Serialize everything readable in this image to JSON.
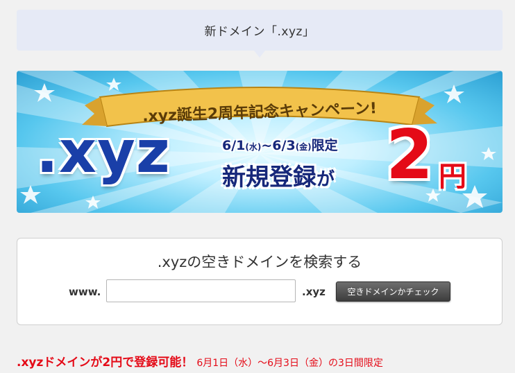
{
  "header": {
    "title": "新ドメイン「.xyz」"
  },
  "banner": {
    "ribbon": ".xyz誕生2周年記念キャンペーン!",
    "logo": ".xyz",
    "date_start": "6/1",
    "day_start": "(水)",
    "tilde": "~",
    "date_end": "6/3",
    "day_end": "(金)",
    "limited": "限定",
    "new_reg": "新規登録",
    "ga": "が",
    "price": "2",
    "yen": "円"
  },
  "search": {
    "title": ".xyzの空きドメインを検索する",
    "prefix": "www.",
    "input_value": "",
    "suffix": ".xyz",
    "button_label": "空きドメインかチェック"
  },
  "promo": {
    "strong": ".xyzドメインが2円で登録可能！",
    "detail": "6月1日（水）～6月3日（金）の3日間限定"
  },
  "colors": {
    "accent_red": "#e40a17",
    "logo_blue": "#1a3fa8",
    "header_bg": "#e6eaf6",
    "ribbon_gold": "#f2c24b"
  }
}
